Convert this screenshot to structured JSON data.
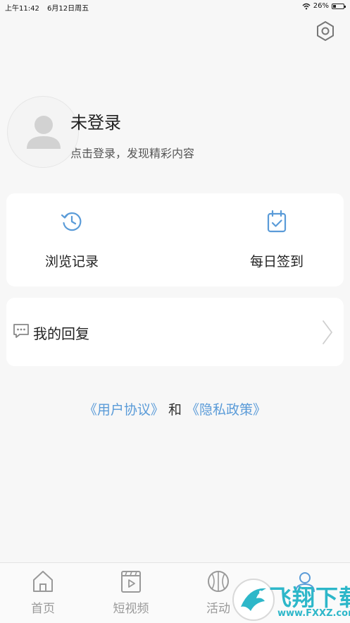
{
  "status_bar": {
    "time": "上午11:42",
    "date": "6月12日周五",
    "battery": "26%"
  },
  "profile": {
    "name": "未登录",
    "subtitle": "点击登录，发现精彩内容"
  },
  "quick_actions": [
    {
      "label": "浏览记录",
      "icon": "history-clock-icon"
    },
    {
      "label": "每日签到",
      "icon": "calendar-check-icon"
    }
  ],
  "reply": {
    "label": "我的回复",
    "icon": "chat-bubble-icon"
  },
  "agreement": {
    "user_agreement": "《用户协议》",
    "and": "和",
    "privacy_policy": "《隐私政策》"
  },
  "tabs": [
    {
      "label": "首页",
      "icon": "home-icon"
    },
    {
      "label": "短视频",
      "icon": "video-play-icon"
    },
    {
      "label": "活动",
      "icon": "basketball-icon"
    },
    {
      "label": "",
      "icon": "user-icon"
    }
  ],
  "watermark": {
    "text": "飞翔下载",
    "url": "www.FXXZ.com"
  },
  "colors": {
    "accent": "#5a9bd8",
    "background": "#f7f7f7",
    "tab_inactive": "#999999",
    "watermark": "#2db7c9"
  }
}
